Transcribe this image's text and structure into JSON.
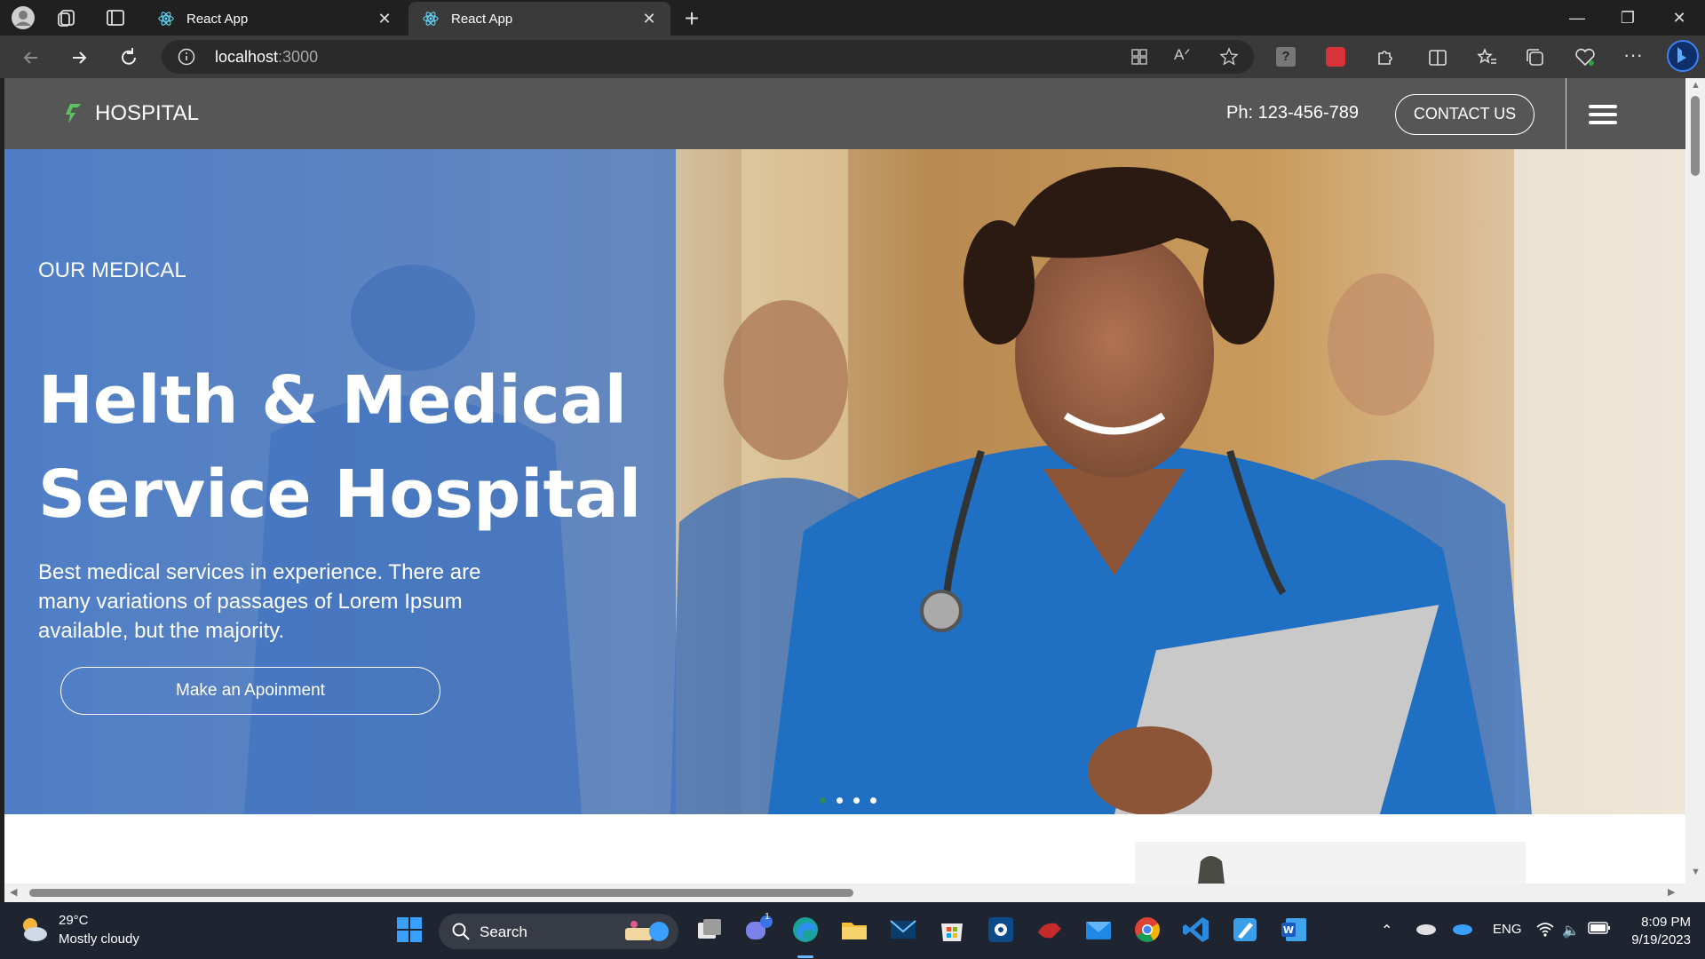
{
  "browser": {
    "tabs": [
      {
        "title": "React App",
        "active": false
      },
      {
        "title": "React App",
        "active": true
      }
    ],
    "new_tab_label": "+",
    "address": {
      "host": "localhost",
      "port": ":3000"
    }
  },
  "page": {
    "brand": "HOSPITAL",
    "phone": "Ph: 123-456-789",
    "contact_label": "CONTACT US",
    "hero": {
      "subtitle": "OUR MEDICAL",
      "title_line1": "Helth & Medical",
      "title_line2": "Service Hospital",
      "description": "Best medical services in experience. There are many variations of passages of Lorem Ipsum available, but the majority.",
      "cta_label": "Make an Apoinment",
      "slides_count": 4,
      "active_slide": 1
    },
    "colors": {
      "navbar": "#565656",
      "hero_overlay": "#4276c4",
      "active_dot": "#2e8b57"
    }
  },
  "taskbar": {
    "weather": {
      "temp": "29°C",
      "condition": "Mostly cloudy"
    },
    "search_label": "Search",
    "tray": {
      "language": "ENG"
    },
    "clock": {
      "time": "8:09 PM",
      "date": "9/19/2023"
    },
    "chat_badge": "1"
  }
}
